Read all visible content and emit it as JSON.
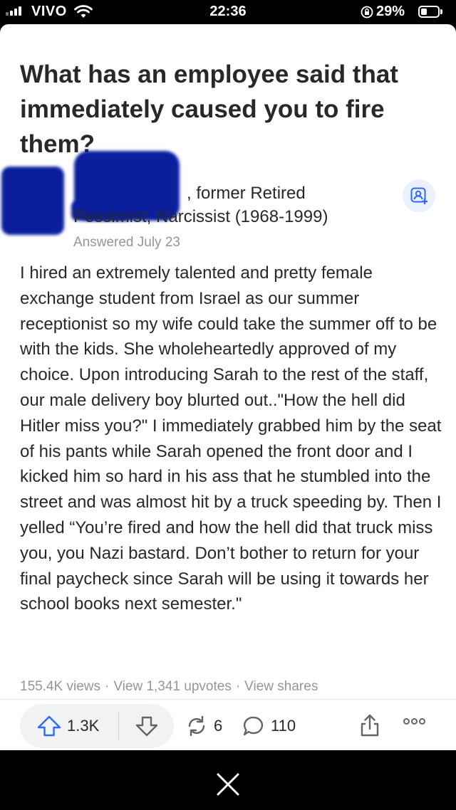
{
  "status_bar": {
    "carrier": "VIVO",
    "time": "22:36",
    "battery_percent": "29%"
  },
  "post": {
    "question": "What has an employee said that immediately caused you to fire them?",
    "author": {
      "line1_visible": ", former Retired",
      "credential_visible": "Pessimist, Narcissist (1968-1999)",
      "answered_date": "Answered July 23"
    },
    "answer_text": "I hired an extremely talented and pretty female exchange student from Israel as our summer receptionist so my wife could take the summer off to be with the kids. She wholeheartedly approved of my choice. Upon introducing Sarah to the rest of the staff, our male delivery boy blurted out..\"How the hell did Hitler miss you?\" I immediately grabbed him by the seat of his pants while Sarah opened the front door and I kicked him so hard in his ass that he stumbled into the street and was almost hit by a truck speeding by. Then I yelled “You’re fired and how the hell did that truck miss you, you Nazi bastard. Don’t bother to return for your final paycheck since Sarah will be using it towards her school books next semester.\"",
    "stats": {
      "views": "155.4K views",
      "upvotes_link": "View 1,341 upvotes",
      "shares_link": "View shares",
      "separator": "·"
    },
    "actions": {
      "upvotes": "1.3K",
      "shares": "6",
      "comments": "110"
    }
  },
  "colors": {
    "accent_blue": "#2e69ff",
    "text": "#282829",
    "muted": "#939598",
    "redaction": "#0b1f9c"
  }
}
